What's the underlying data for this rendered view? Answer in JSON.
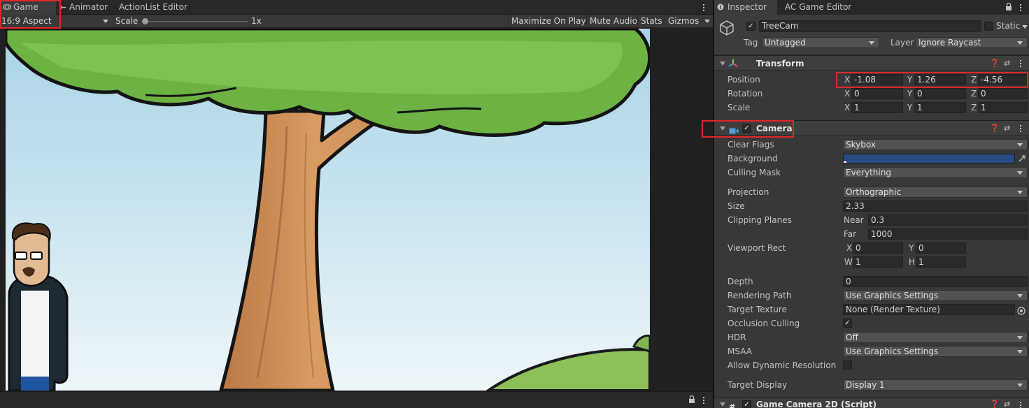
{
  "game_view": {
    "tabs": [
      {
        "label": "Game",
        "icon": "gamepad-icon"
      },
      {
        "label": "Animator",
        "icon": "animator-icon"
      },
      {
        "label": "ActionList Editor"
      }
    ],
    "aspect": "16:9 Aspect",
    "scale_label": "Scale",
    "scale_value": "1x",
    "buttons": [
      "Maximize On Play",
      "Mute Audio",
      "Stats",
      "Gizmos"
    ]
  },
  "inspector": {
    "tabs": [
      {
        "label": "Inspector",
        "icon": "info-icon"
      },
      {
        "label": "AC Game Editor"
      }
    ],
    "object_name": "TreeCam",
    "static_label": "Static",
    "tag_label": "Tag",
    "tag_value": "Untagged",
    "layer_label": "Layer",
    "layer_value": "Ignore Raycast",
    "transform": {
      "title": "Transform",
      "position_label": "Position",
      "rotation_label": "Rotation",
      "scale_label": "Scale",
      "position": {
        "x": "-1.08",
        "y": "1.26",
        "z": "-4.56"
      },
      "rotation": {
        "x": "0",
        "y": "0",
        "z": "0"
      },
      "scale": {
        "x": "1",
        "y": "1",
        "z": "1"
      }
    },
    "camera": {
      "title": "Camera",
      "clear_flags_label": "Clear Flags",
      "clear_flags": "Skybox",
      "background_label": "Background",
      "background_color": "#2a4a82",
      "culling_mask_label": "Culling Mask",
      "culling_mask": "Everything",
      "projection_label": "Projection",
      "projection": "Orthographic",
      "size_label": "Size",
      "size": "2.33",
      "clipping_label": "Clipping Planes",
      "near_label": "Near",
      "near": "0.3",
      "far_label": "Far",
      "far": "1000",
      "viewport_label": "Viewport Rect",
      "viewport": {
        "x": "0",
        "y": "0",
        "w": "1",
        "h": "1"
      },
      "depth_label": "Depth",
      "depth": "0",
      "rendering_path_label": "Rendering Path",
      "rendering_path": "Use Graphics Settings",
      "target_texture_label": "Target Texture",
      "target_texture": "None (Render Texture)",
      "occlusion_label": "Occlusion Culling",
      "hdr_label": "HDR",
      "hdr": "Off",
      "msaa_label": "MSAA",
      "msaa": "Use Graphics Settings",
      "dynres_label": "Allow Dynamic Resolution",
      "target_display_label": "Target Display",
      "target_display": "Display 1"
    },
    "next_component": "Game Camera 2D (Script)"
  },
  "axis": {
    "x": "X",
    "y": "Y",
    "z": "Z",
    "w": "W",
    "h": "H"
  },
  "colors": {
    "highlight": "#e0262a",
    "accent_blue": "#4aa0e0"
  }
}
